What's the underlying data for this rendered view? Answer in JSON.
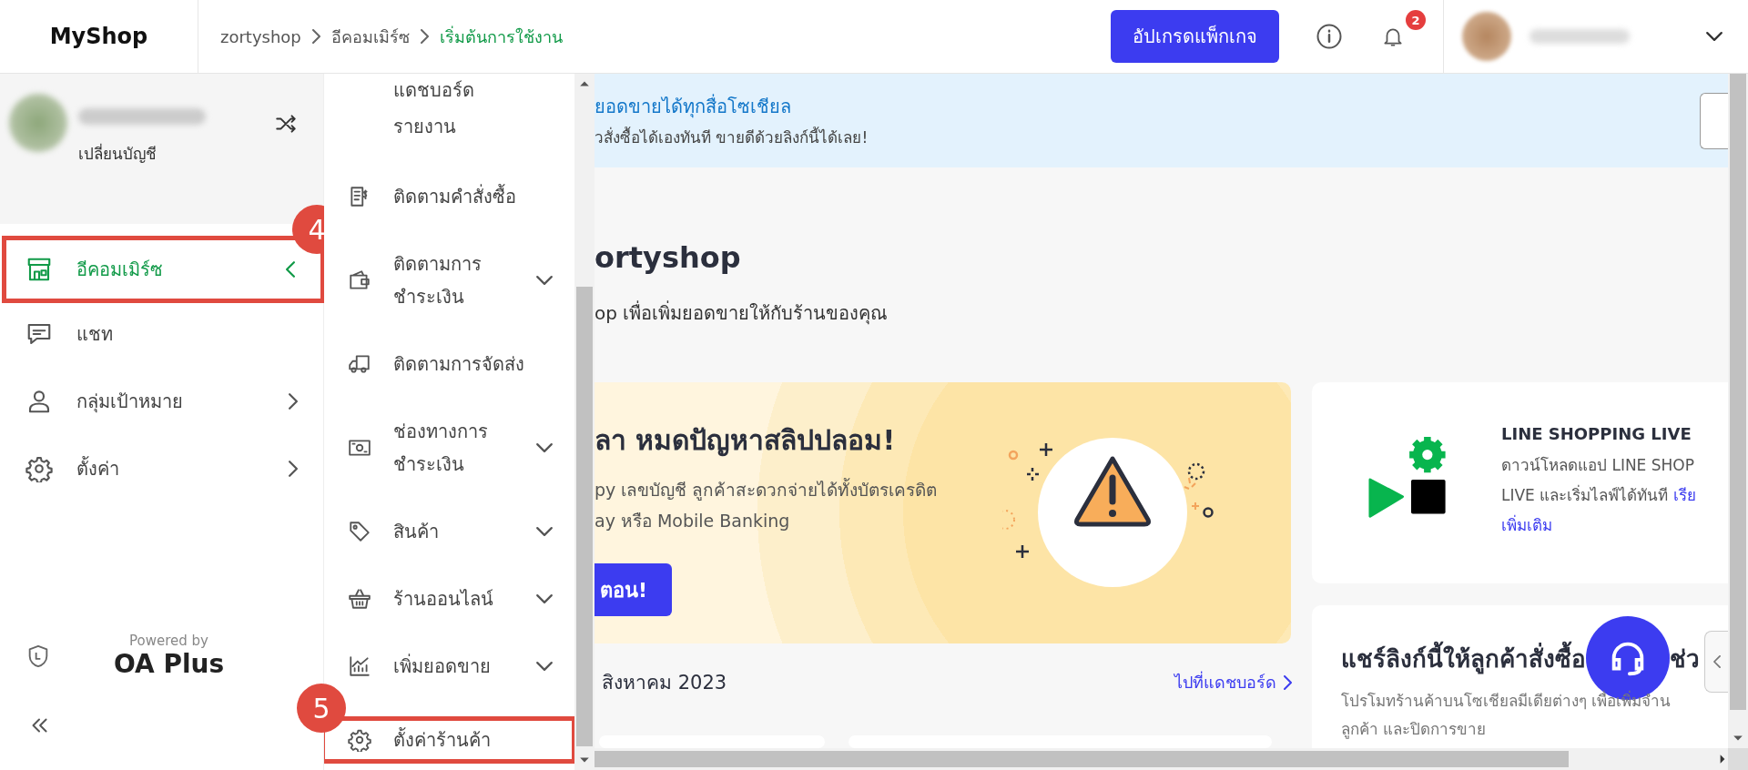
{
  "header": {
    "logo": "MyShop",
    "breadcrumbs": [
      {
        "label": "zortyshop",
        "current": false
      },
      {
        "label": "อีคอมเมิร์ซ",
        "current": false
      },
      {
        "label": "เริ่มต้นการใช้งาน",
        "current": true
      }
    ],
    "upgrade_button": "อัปเกรดแพ็กเกจ",
    "notification_count": "2"
  },
  "sidebar": {
    "switch_account": "เปลี่ยนบัญชี",
    "items": [
      {
        "label": "อีคอมเมิร์ซ",
        "kind": "group",
        "selected": true,
        "expanded": true,
        "annotation": "4"
      },
      {
        "label": "แชท",
        "kind": "link",
        "selected": false
      },
      {
        "label": "กลุ่มเป้าหมาย",
        "kind": "group",
        "selected": false,
        "expanded": false
      },
      {
        "label": "ตั้งค่า",
        "kind": "group",
        "selected": false,
        "expanded": false
      }
    ],
    "powered_by": "Powered by",
    "brand": "OA Plus"
  },
  "submenu": {
    "items": [
      {
        "label": "แดชบอร์ด",
        "kind": "plain"
      },
      {
        "label": "รายงาน",
        "kind": "plain"
      },
      {
        "label": "ติดตามคำสั่งซื้อ",
        "kind": "link"
      },
      {
        "label": "ติดตามการ\nชำระเงิน",
        "kind": "group"
      },
      {
        "label": "ติดตามการจัดส่ง",
        "kind": "link"
      },
      {
        "label": "ช่องทางการ\nชำระเงิน",
        "kind": "group"
      },
      {
        "label": "สินค้า",
        "kind": "group"
      },
      {
        "label": "ร้านออนไลน์",
        "kind": "group"
      },
      {
        "label": "เพิ่มยอดขาย",
        "kind": "group"
      },
      {
        "label": "ตั้งค่าร้านค้า",
        "kind": "link",
        "annotation": "5"
      }
    ]
  },
  "banner": {
    "title": "ยอดขายได้ทุกสื่อโซเชียล",
    "text": "วสั่งซื้อได้เองทันที ขายดีด้วยลิงก์นี้ได้เลย!"
  },
  "page": {
    "title": "ortyshop",
    "subtitle": "op เพื่อเพิ่มยอดขายให้กับร้านของคุณ"
  },
  "promo": {
    "title": "ลา หมดปัญหาสลิปปลอม!",
    "text": "py เลขบัญชี ลูกค้าสะดวกจ่ายได้ทั้งบัตรเครดิต\nay หรือ Mobile Banking",
    "button": "ตอน!"
  },
  "summary": {
    "period": "สิงหาคม 2023",
    "link": "ไปที่แดชบอร์ด"
  },
  "line_card": {
    "title": "LINE SHOPPING LIVE",
    "lines": [
      "ดาวน์โหลดแอป LINE SHOP",
      "LIVE และเริ่มไลฟ์ได้ทันที"
    ],
    "links": [
      "เรีย",
      "เพิ่มเติม"
    ]
  },
  "share_card": {
    "title_parts": [
      "แชร์ลิงก์นี้ให้ลูกค้าสั่งซื้อ",
      "ช่ว"
    ],
    "text": "โปรโมทร้านค้าบนโซเชียลมีเดียต่างๆ เพื่อเพิ่มจำน\nลูกค้า และปิดการขาย"
  }
}
